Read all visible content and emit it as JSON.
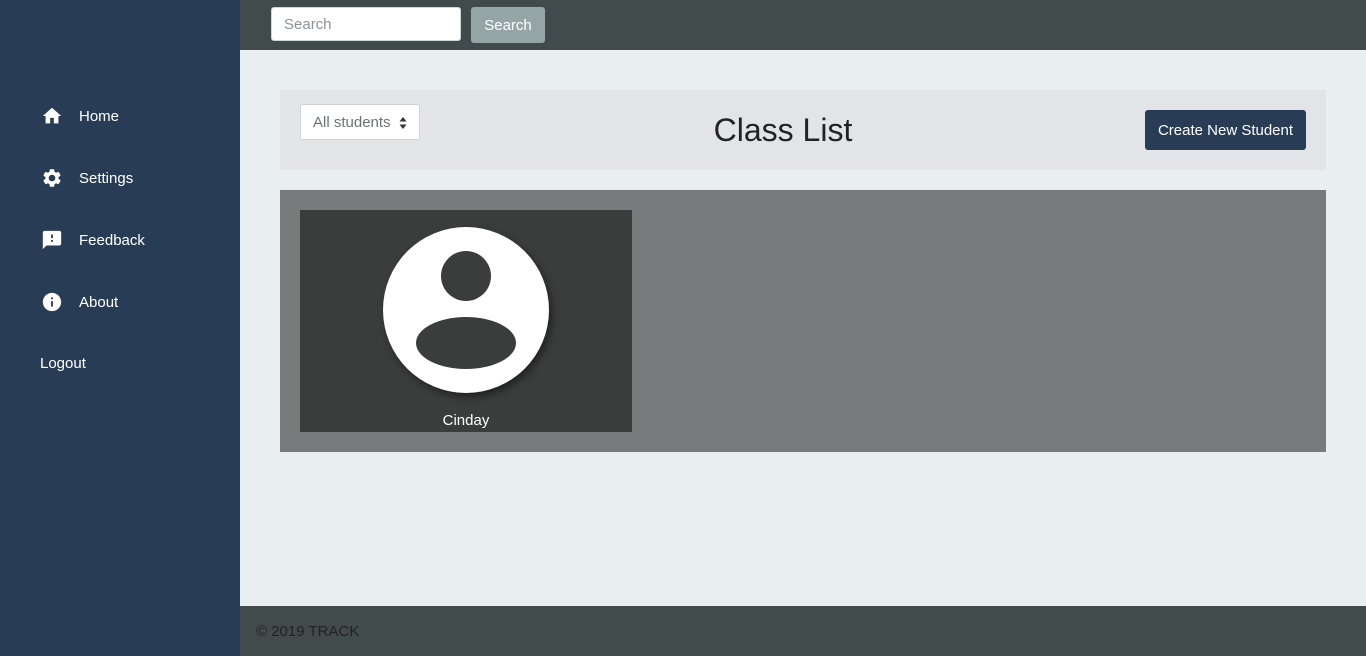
{
  "sidebar": {
    "items": [
      {
        "label": "Home",
        "icon": "home-icon"
      },
      {
        "label": "Settings",
        "icon": "gear-icon"
      },
      {
        "label": "Feedback",
        "icon": "feedback-icon"
      },
      {
        "label": "About",
        "icon": "info-icon"
      }
    ],
    "logout_label": "Logout"
  },
  "topbar": {
    "search_placeholder": "Search",
    "search_value": "",
    "search_button_label": "Search"
  },
  "header": {
    "filter_selected": "All students",
    "title": "Class List",
    "create_button_label": "Create New Student"
  },
  "students": [
    {
      "name": "Cinday",
      "avatar_icon": "user-avatar-icon"
    }
  ],
  "footer": {
    "copyright": "© 2019 TRACK"
  },
  "colors": {
    "sidebar": "#283d55",
    "topbar": "#424b4b",
    "accent_button": "#283d55",
    "search_button": "#95a5a6",
    "content_bg": "#e9eef0",
    "card_area": "#777b7c",
    "card": "#3b3d3c"
  }
}
